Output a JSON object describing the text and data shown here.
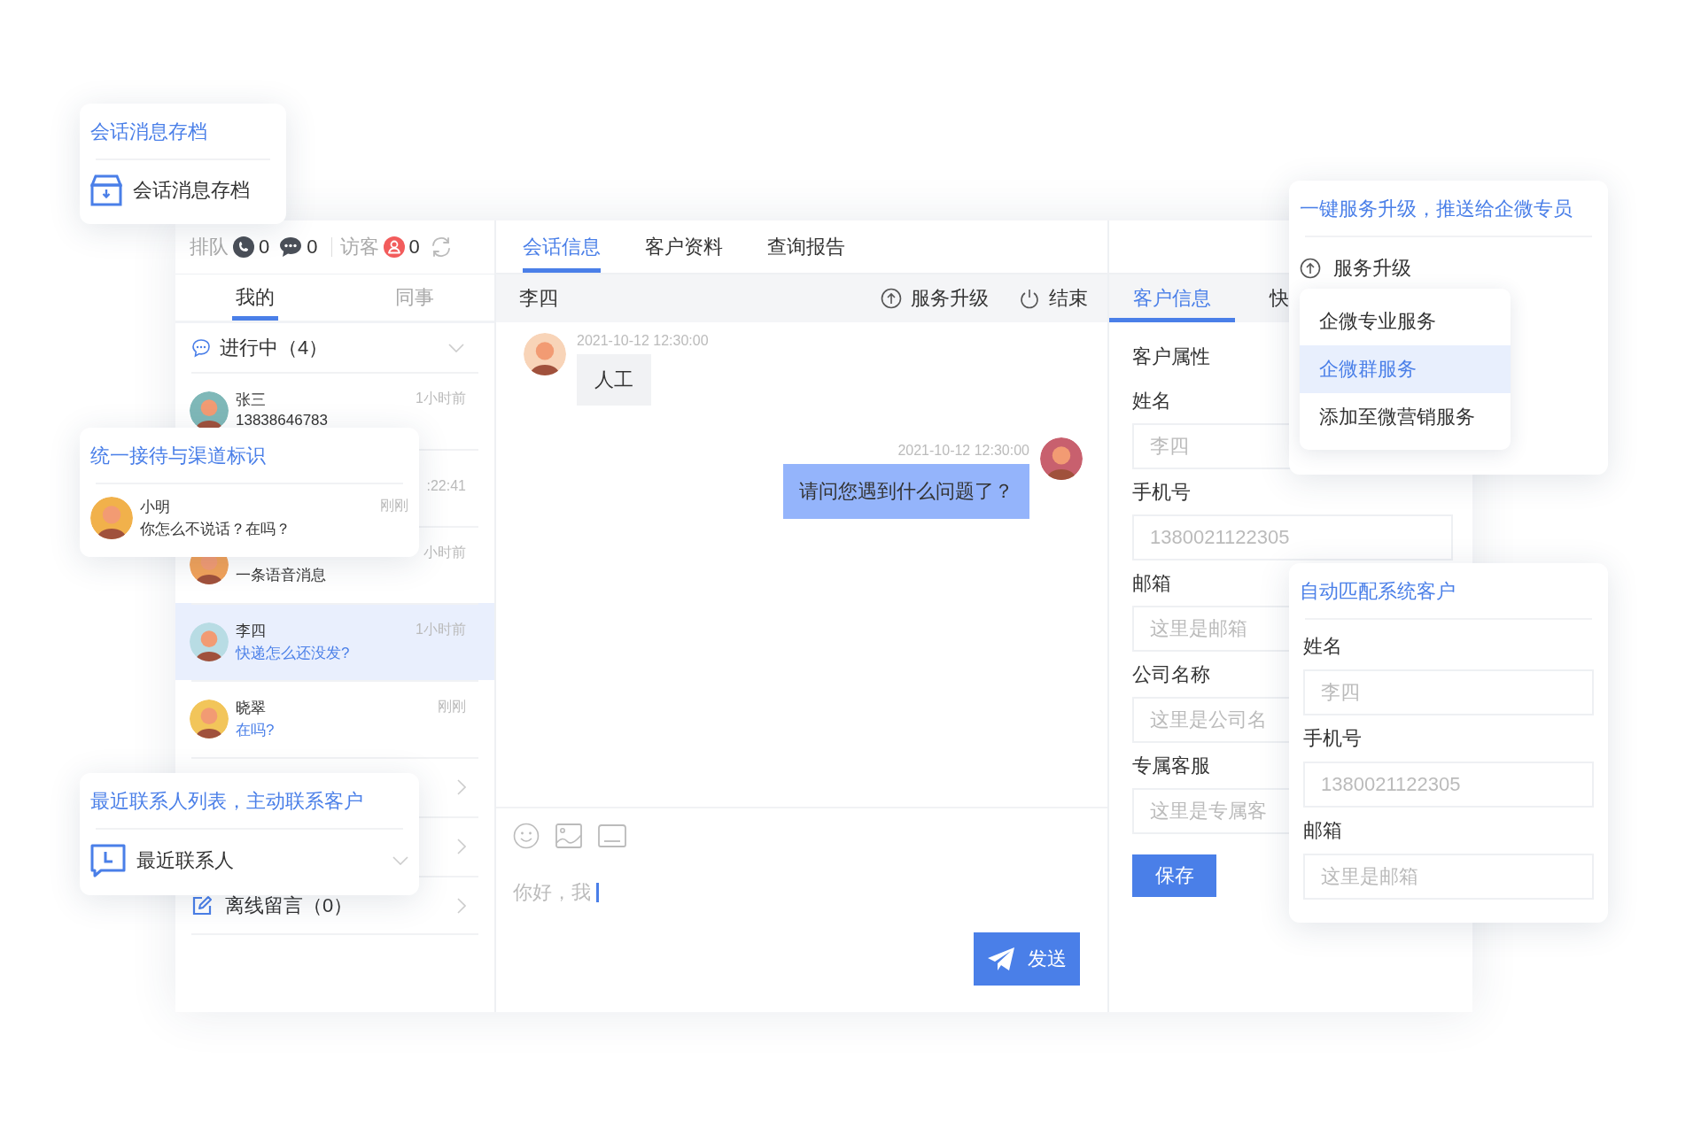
{
  "archive_card": {
    "title": "会话消息存档",
    "item": "会话消息存档"
  },
  "queue_bar": {
    "queue_label": "排队",
    "phone_count": "0",
    "chat_count": "0",
    "visitor_label": "访客",
    "visitor_count": "0"
  },
  "left_tabs": [
    {
      "label": "我的",
      "selected": true
    },
    {
      "label": "同事",
      "selected": false
    }
  ],
  "ongoing": {
    "label": "进行中（4）"
  },
  "conversations": [
    {
      "name": "张三",
      "message": "13838646783",
      "time": "1小时前",
      "highlighted": false,
      "selected": false
    },
    {
      "time": ":22:41",
      "selected": false
    },
    {
      "message": "一条语音消息",
      "time": "小时前",
      "highlighted": false,
      "selected": false
    },
    {
      "name": "李四",
      "message": "快递怎么还没发?",
      "time": "1小时前",
      "highlighted": true,
      "selected": true
    },
    {
      "name": "晓翠",
      "message": "在吗?",
      "time": "刚刚",
      "highlighted": true,
      "selected": false
    }
  ],
  "offline_section": {
    "label": "离线留言（0）"
  },
  "chat_tabs": [
    {
      "label": "会话信息",
      "selected": true
    },
    {
      "label": "客户资料",
      "selected": false
    },
    {
      "label": "查询报告",
      "selected": false
    }
  ],
  "chat_header": {
    "contact": "李四",
    "actions": [
      {
        "kind": "upgrade",
        "label": "服务升级"
      },
      {
        "kind": "end",
        "label": "结束"
      }
    ]
  },
  "messages": [
    {
      "kind": "incoming",
      "time": "2021-10-12 12:30:00",
      "text": "人工"
    },
    {
      "kind": "outgoing",
      "time": "2021-10-12 12:30:00",
      "text": "请问您遇到什么问题了？"
    }
  ],
  "composer": {
    "value": "你好，我",
    "send": "发送"
  },
  "info_tabs": [
    {
      "label": "客户信息",
      "selected": true
    },
    {
      "label": "快",
      "selected": false
    }
  ],
  "customer_form": {
    "section": "客户属性",
    "fields": [
      {
        "label": "姓名",
        "placeholder": "李四"
      },
      {
        "label": "手机号",
        "placeholder": "1380021122305"
      },
      {
        "label": "邮箱",
        "placeholder": "这里是邮箱"
      },
      {
        "label": "公司名称",
        "placeholder": "这里是公司名"
      },
      {
        "label": "专属客服",
        "placeholder": "这里是专属客"
      }
    ],
    "save": "保存"
  },
  "channel_card": {
    "title": "统一接待与渠道标识",
    "contact": {
      "name": "小明",
      "message": "你怎么不说话？在吗？",
      "time": "刚刚"
    }
  },
  "recent_card": {
    "title": "最近联系人列表，主动联系客户",
    "item": "最近联系人"
  },
  "upgrade_card": {
    "title": "一键服务升级，推送给企微专员",
    "action": "服务升级",
    "options": [
      {
        "label": "企微专业服务",
        "selected": false
      },
      {
        "label": "企微群服务",
        "selected": true
      },
      {
        "label": "添加至微营销服务",
        "selected": false
      }
    ]
  },
  "match_card": {
    "title": "自动匹配系统客户",
    "fields": [
      {
        "label": "姓名",
        "placeholder": "李四"
      },
      {
        "label": "手机号",
        "placeholder": "1380021122305"
      },
      {
        "label": "邮箱",
        "placeholder": "这里是邮箱"
      }
    ]
  }
}
